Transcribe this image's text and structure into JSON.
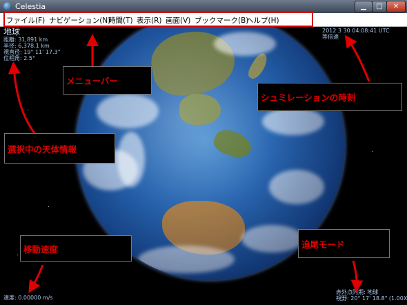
{
  "window": {
    "title": "Celestia",
    "minimize_label": "▁",
    "maximize_label": "□",
    "close_label": "✕"
  },
  "menu": [
    {
      "label": "ファイル(F)"
    },
    {
      "label": "ナビゲーション(N)"
    },
    {
      "label": "時間(T)"
    },
    {
      "label": "表示(R)"
    },
    {
      "label": "画面(V)"
    },
    {
      "label": "ブックマーク(B)"
    },
    {
      "label": "ヘルプ(H)"
    }
  ],
  "object_info": {
    "name": "地球",
    "distance": "距離: 31,891 km",
    "radius": "半径: 6,378.1 km",
    "apparent_diameter": "視直径: 19° 11' 17.3\"",
    "phase_angle": "位相角: 2.5°"
  },
  "time_info": {
    "datetime": "2012 3 30 04:08:41 UTC",
    "rate": "等倍速"
  },
  "speed_info": {
    "speed": "速度: 0.00000 m/s"
  },
  "tracking_info": {
    "mode": "赤外点同期: 地球",
    "fov": "視野: 20° 17' 18.8\" (1.00X)"
  },
  "annotations": {
    "menubar": "メニューバー",
    "sim_time": "シュミレーションの時刻",
    "object_info": "選択中の天体情報",
    "speed": "移動速度",
    "tracking": "追尾モード"
  },
  "colors": {
    "annotation_red": "#e00000",
    "hud_text": "#a9c6ea"
  }
}
